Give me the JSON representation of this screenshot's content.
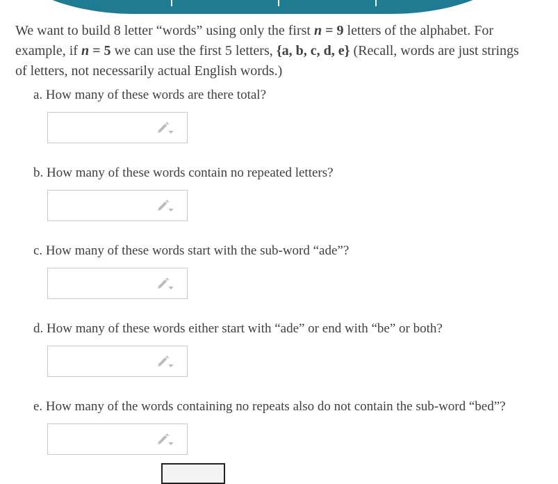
{
  "banner": {
    "color": "#1f7b91",
    "tab_separator_positions": [
      246,
      400,
      540
    ]
  },
  "intro": {
    "text_1": "We want to build 8 letter “words” using only the first ",
    "math_n1": "n",
    "math_eq1": " = ",
    "math_9": "9",
    "text_2": " letters of the alphabet. For example, if ",
    "math_n2": "n",
    "math_eq2": " = ",
    "math_5": "5",
    "text_3": " we can use the first 5 letters, ",
    "math_set": "{a, b, c, d, e}",
    "text_4": " (Recall, words are just strings of letters, not necessarily actual English words.)"
  },
  "parts": [
    {
      "id": "a",
      "label": "a.",
      "question": "a. How many of these words are there total?",
      "input_value": "",
      "input_placeholder": "",
      "icon": "pencil-icon",
      "dropdown_icon": "chevron-down-icon"
    },
    {
      "id": "b",
      "label": "b.",
      "question": "b. How many of these words contain no repeated letters?",
      "input_value": "",
      "input_placeholder": "",
      "icon": "pencil-icon",
      "dropdown_icon": "chevron-down-icon"
    },
    {
      "id": "c",
      "label": "c.",
      "question": "c. How many of these words start with the sub-word “ade”?",
      "input_value": "",
      "input_placeholder": "",
      "icon": "pencil-icon",
      "dropdown_icon": "chevron-down-icon"
    },
    {
      "id": "d",
      "label": "d.",
      "question": "d. How many of these words either start with “ade” or end with “be” or both?",
      "input_value": "",
      "input_placeholder": "",
      "icon": "pencil-icon",
      "dropdown_icon": "chevron-down-icon"
    },
    {
      "id": "e",
      "label": "e.",
      "question": "e. How many of the words containing no repeats also do not contain the sub-word “bed”?",
      "input_value": "",
      "input_placeholder": "",
      "icon": "pencil-icon",
      "dropdown_icon": "chevron-down-icon"
    }
  ],
  "footer": {
    "submit_label": ""
  },
  "colors": {
    "banner_teal": "#1f7b91",
    "text": "#3f3f3f",
    "input_border": "#c9c9c9",
    "icon_gray": "#b9bcc0",
    "page_background": "#ffffff"
  }
}
